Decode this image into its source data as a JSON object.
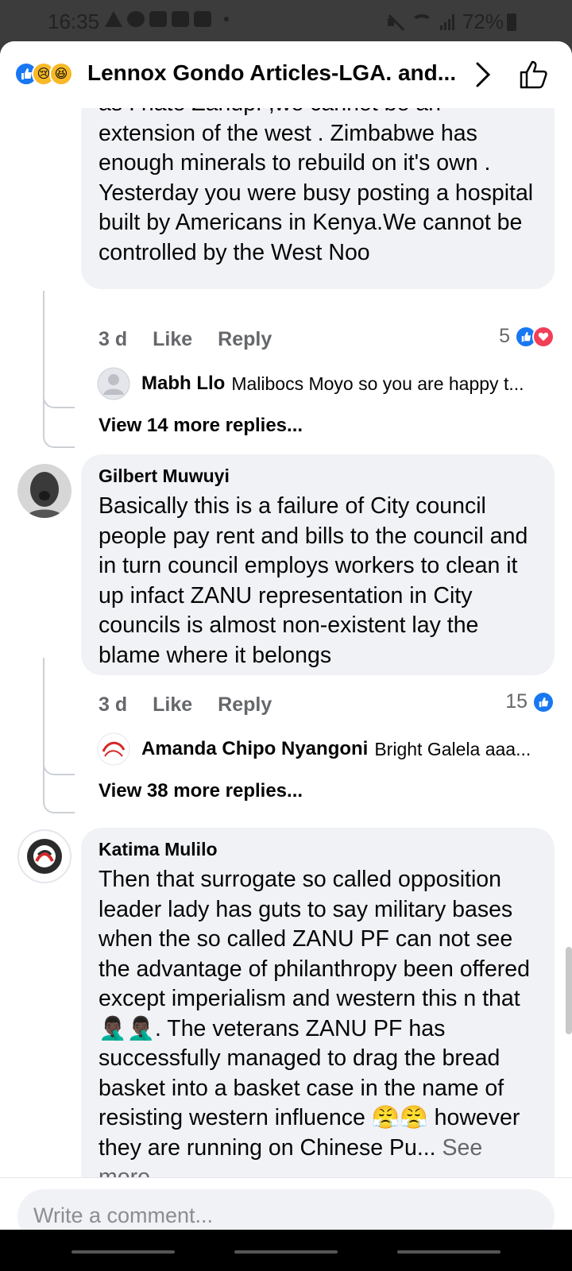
{
  "status_bar": {
    "time": "16:35",
    "battery": "72%"
  },
  "header": {
    "title": "Lennox Gondo Articles-LGA. and...",
    "reaction_icons": [
      "like-icon",
      "sad-emoji-icon",
      "haha-emoji-icon"
    ]
  },
  "comments": [
    {
      "text": "as I hate Zanupf ,we cannot be an extension of the west . Zimbabwe has enough minerals to rebuild on it's own . Yesterday you were busy posting a hospital built by Americans in Kenya.We cannot be controlled by the West Noo",
      "age": "3 d",
      "like_label": "Like",
      "reply_label": "Reply",
      "reaction_count": "5",
      "reply_preview": {
        "name": "Mabh Llo",
        "text": "Malibocs Moyo so you are happy t..."
      },
      "view_more": "View 14 more replies..."
    },
    {
      "name": "Gilbert Muwuyi",
      "text": "Basically this is a failure of City council people pay rent and bills to the council and in turn council employs workers to clean it up infact ZANU representation in City councils is almost non-existent lay the blame where it belongs",
      "age": "3 d",
      "like_label": "Like",
      "reply_label": "Reply",
      "reaction_count": "15",
      "reply_preview": {
        "name": "Amanda Chipo Nyangoni",
        "text": "Bright Galela aaa..."
      },
      "view_more": "View 38 more replies..."
    },
    {
      "name": "Katima Mulilo",
      "text_part1": "Then that surrogate so called opposition leader lady has guts to say military bases when the so called ZANU PF can not see the advantage of philanthropy been offered except imperialism and western this n that🤦🏿‍♂️🤦🏿‍♂️. The veterans ZANU PF has successfully managed to drag the bread basket into a basket case in the name of resisting western influence 😤😤 however they are running on Chinese Pu...",
      "see_more": "See more"
    }
  ],
  "composer": {
    "placeholder": "Write a comment..."
  },
  "colors": {
    "accent": "#1877f2",
    "love": "#f33e58",
    "bubble": "#f0f2f5",
    "meta_text": "#65676b"
  }
}
